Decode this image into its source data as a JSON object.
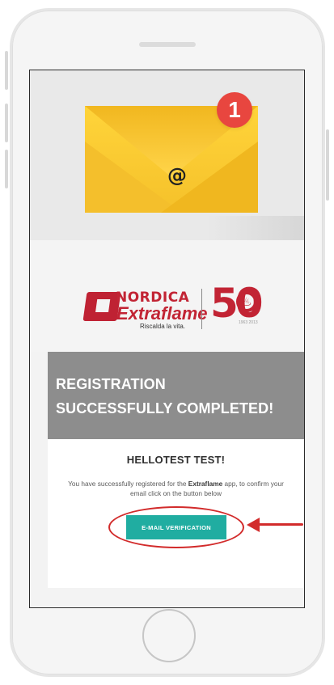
{
  "hero": {
    "at_symbol": "@",
    "notification_count": "1",
    "icons": {
      "envelope": "envelope-icon",
      "badge": "notification-badge-icon"
    }
  },
  "brand": {
    "name_top": "NORDICA",
    "name_bottom": "Extraflame",
    "tagline": "Riscalda la vita.",
    "anniversary_number": "50",
    "anniversary_years": "1963 2013",
    "flame_icon": "flame-icon"
  },
  "banner": {
    "line1": "REGISTRATION",
    "line2": "SUCCESSFULLY COMPLETED!"
  },
  "content": {
    "greeting": "HELLOTEST TEST!",
    "message_before": "You have successfully registered for the ",
    "message_emphasis": "Extraflame",
    "message_after": " app, to confirm your email click on the button below",
    "button_label": "E-MAIL VERIFICATION"
  },
  "colors": {
    "accent": "#20ada1",
    "brand_red": "#c22434",
    "annotation_red": "#d22b2b",
    "banner_gray": "#8d8d8d",
    "badge_red": "#e8463f",
    "envelope_yellow": "#f5c12a"
  },
  "annotations": {
    "highlight_ring": "focus-ring",
    "pointer": "arrow-pointer"
  }
}
